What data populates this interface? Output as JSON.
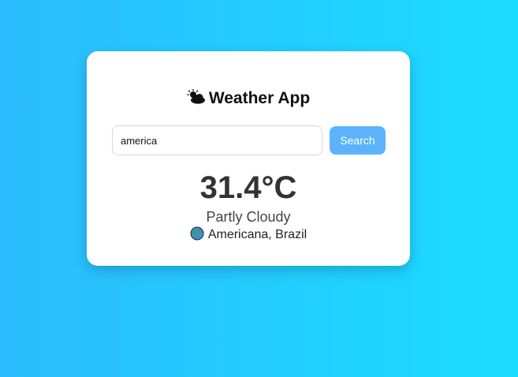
{
  "app": {
    "title": "Weather App",
    "title_icon": "sun-behind-cloud-icon"
  },
  "search": {
    "value": "america",
    "placeholder": "",
    "button_label": "Search"
  },
  "weather": {
    "temperature": "31.4°C",
    "condition": "Partly Cloudy",
    "location": "Americana, Brazil",
    "location_icon": "globe-icon"
  },
  "colors": {
    "background_start": "#2cbcfd",
    "background_end": "#1bdcff",
    "button": "#5cb3fb",
    "card": "#ffffff"
  }
}
